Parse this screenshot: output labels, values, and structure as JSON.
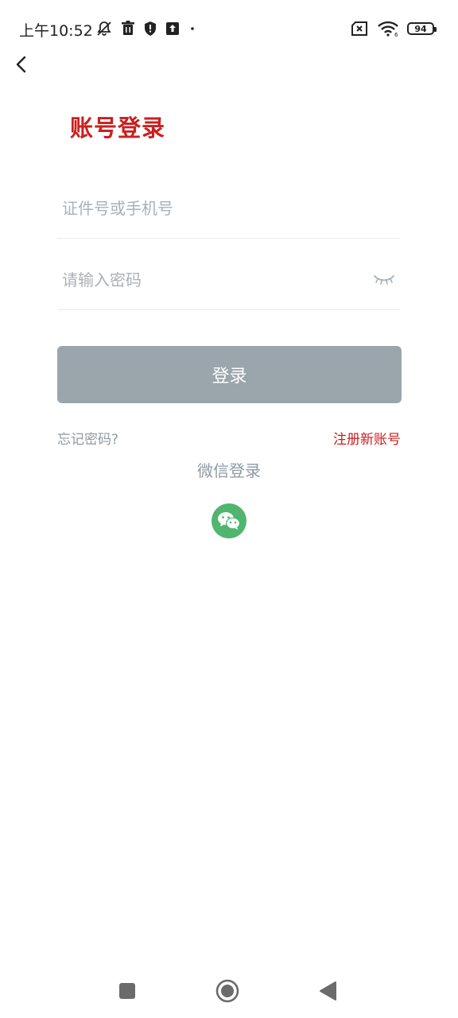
{
  "status_bar": {
    "time": "上午10:52",
    "battery_level": "94",
    "icons": [
      "mute-bell-icon",
      "trash-icon",
      "shield-icon",
      "upload-icon",
      "dot-icon",
      "sim-x-icon",
      "wifi-icon",
      "battery-icon"
    ]
  },
  "header": {
    "back_icon": "chevron-left-icon"
  },
  "login": {
    "title": "账号登录",
    "account_placeholder": "证件号或手机号",
    "password_placeholder": "请输入密码",
    "password_visibility_icon": "eye-closed-icon",
    "submit_label": "登录",
    "forgot_label": "忘记密码?",
    "register_label": "注册新账号",
    "wechat_label": "微信登录",
    "wechat_icon": "wechat-icon"
  },
  "colors": {
    "accent_red": "#c9201f",
    "button_disabled": "#9ba5ac",
    "wechat_green": "#4fb56f",
    "muted_text": "#8f9aa3"
  },
  "nav_bar": {
    "icons": [
      "recent-apps-icon",
      "home-icon",
      "back-triangle-icon"
    ]
  }
}
